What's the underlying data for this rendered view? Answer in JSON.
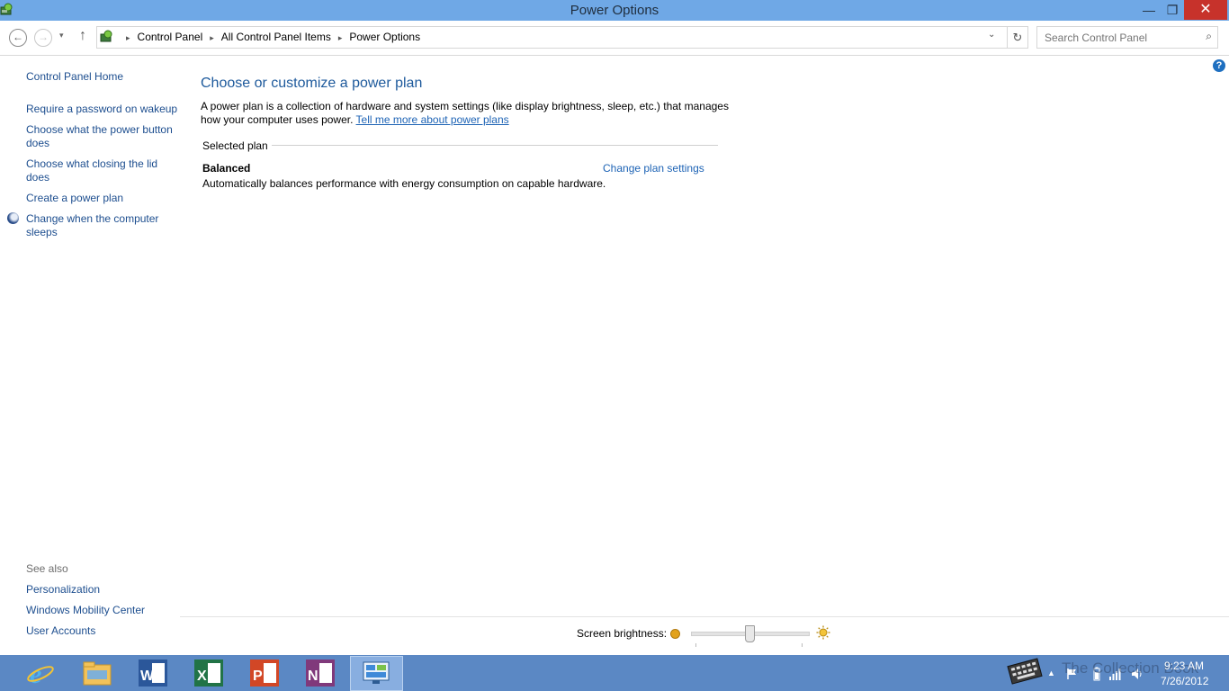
{
  "window": {
    "title": "Power Options",
    "min_glyph": "—",
    "max_glyph": "❐",
    "close_glyph": "✕"
  },
  "address": {
    "back_glyph": "←",
    "forward_glyph": "→",
    "history_glyph": "▾",
    "up_glyph": "↑",
    "breadcrumbs": [
      "Control Panel",
      "All Control Panel Items",
      "Power Options"
    ],
    "breadcrumb_sep": "▸",
    "dropdown_glyph": "⌄",
    "refresh_glyph": "↻",
    "search_placeholder": "Search Control Panel",
    "search_glyph": "⌕"
  },
  "help": {
    "glyph": "?"
  },
  "left_pane": {
    "home": "Control Panel Home",
    "tasks": [
      "Require a password on wakeup",
      "Choose what the power button does",
      "Choose what closing the lid does",
      "Create a power plan",
      "Change when the computer sleeps"
    ],
    "see_also_label": "See also",
    "see_also": [
      "Personalization",
      "Windows Mobility Center",
      "User Accounts"
    ]
  },
  "main": {
    "title": "Choose or customize a power plan",
    "intro_text": "A power plan is a collection of hardware and system settings (like display brightness, sleep, etc.) that manages how your computer uses power. ",
    "intro_link": "Tell me more about power plans",
    "selected_plan_label": "Selected plan",
    "plan": {
      "name": "Balanced",
      "change_link": "Change plan settings",
      "description": "Automatically balances performance with energy consumption on capable hardware."
    }
  },
  "brightness": {
    "label": "Screen brightness:",
    "level": 0.5
  },
  "taskbar": {
    "apps": [
      "internet-explorer",
      "file-explorer",
      "word",
      "excel",
      "powerpoint",
      "onenote",
      "control-panel"
    ],
    "tray_up_glyph": "▲",
    "time": "9:23 AM",
    "date": "7/26/2012"
  },
  "colors": {
    "titlebar": "#6fa8e6",
    "taskbar": "#5b88c4",
    "link": "#1d4e8f",
    "heading": "#1e5a9c",
    "close": "#c7322b"
  }
}
